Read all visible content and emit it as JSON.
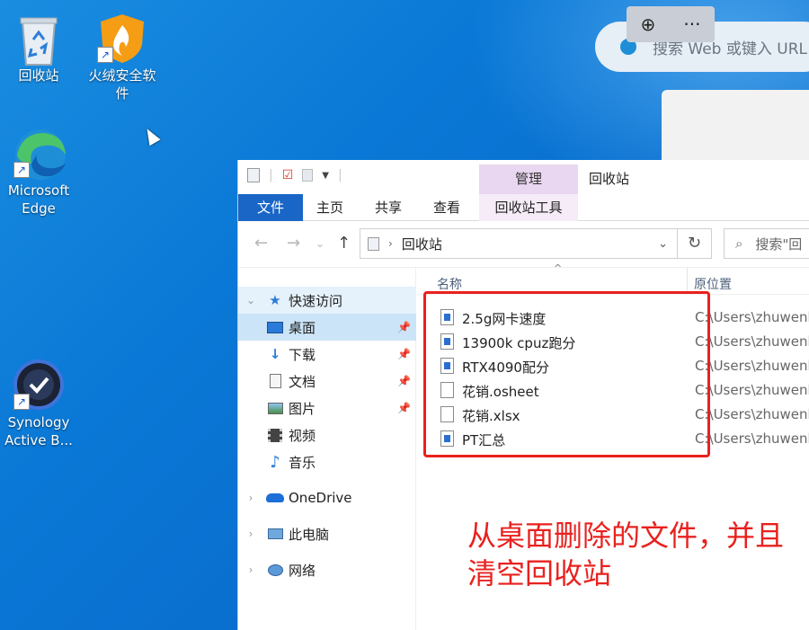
{
  "desktop": {
    "icons": [
      {
        "label": "回收站",
        "icon": "recycle-bin-icon"
      },
      {
        "label": "火绒安全软件",
        "icon": "huorong-shield-icon"
      },
      {
        "label": "Microsoft Edge",
        "icon": "edge-icon"
      },
      {
        "label": "Synology Active B...",
        "icon": "synology-icon"
      }
    ]
  },
  "browser": {
    "search_placeholder": "搜索 Web 或键入 URL",
    "zoom_icon": "zoom-icon",
    "more_label": "···"
  },
  "explorer": {
    "title": "回收站",
    "manage_tab": "管理",
    "ribbon_tabs": [
      "文件",
      "主页",
      "共享",
      "查看",
      "回收站工具"
    ],
    "address": "回收站",
    "search_placeholder": "搜索\"回",
    "nav": [
      {
        "label": "快速访问",
        "icon": "star-icon"
      },
      {
        "label": "桌面",
        "icon": "desktop-icon"
      },
      {
        "label": "下载",
        "icon": "download-icon"
      },
      {
        "label": "文档",
        "icon": "document-icon"
      },
      {
        "label": "图片",
        "icon": "pictures-icon"
      },
      {
        "label": "视频",
        "icon": "video-icon"
      },
      {
        "label": "音乐",
        "icon": "music-icon"
      },
      {
        "label": "OneDrive",
        "icon": "onedrive-icon"
      },
      {
        "label": "此电脑",
        "icon": "computer-icon"
      },
      {
        "label": "网络",
        "icon": "network-icon"
      }
    ],
    "columns": {
      "name": "名称",
      "original_location": "原位置"
    },
    "files": [
      {
        "name": "2.5g网卡速度",
        "location": "C:\\Users\\zhuwenb",
        "type": "image"
      },
      {
        "name": "13900k cpuz跑分",
        "location": "C:\\Users\\zhuwenb",
        "type": "image"
      },
      {
        "name": "RTX4090配分",
        "location": "C:\\Users\\zhuwenb",
        "type": "image"
      },
      {
        "name": "花销.osheet",
        "location": "C:\\Users\\zhuwenb",
        "type": "doc"
      },
      {
        "name": "花销.xlsx",
        "location": "C:\\Users\\zhuwenb",
        "type": "doc"
      },
      {
        "name": "PT汇总",
        "location": "C:\\Users\\zhuwenb",
        "type": "image"
      }
    ]
  },
  "annotation": {
    "line1": "从桌面删除的文件，并且",
    "line2": "清空回收站",
    "color": "#e8211e"
  }
}
